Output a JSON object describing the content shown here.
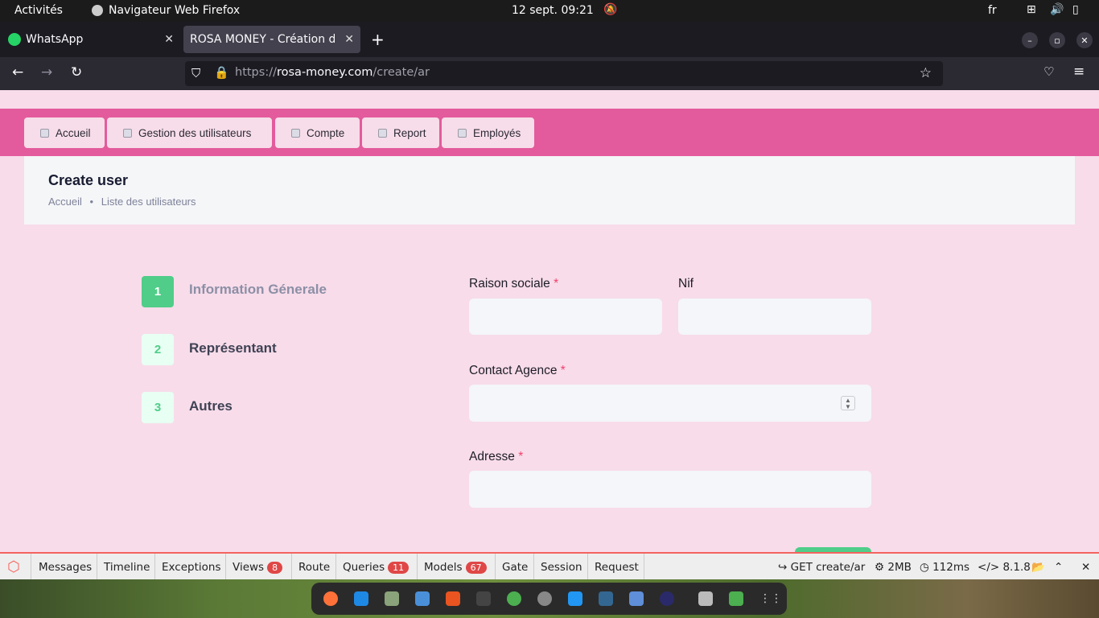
{
  "system_bar": {
    "activities": "Activités",
    "app_name": "Navigateur Web Firefox",
    "datetime": "12 sept.  09:21",
    "lang": "fr"
  },
  "tabs": [
    {
      "label": "WhatsApp"
    },
    {
      "label": "ROSA MONEY - Création d'u"
    }
  ],
  "url": {
    "scheme": "https://",
    "domain": "rosa-money.com",
    "path": "/create/ar"
  },
  "menu": {
    "items": [
      "Accueil",
      "Gestion des utilisateurs",
      "Compte",
      "Report",
      "Employés"
    ]
  },
  "header": {
    "title": "Create user",
    "breadcrumb": [
      "Accueil",
      "Liste des utilisateurs"
    ]
  },
  "steps": [
    {
      "num": "1",
      "label": "Information Génerale"
    },
    {
      "num": "2",
      "label": "Représentant"
    },
    {
      "num": "3",
      "label": "Autres"
    }
  ],
  "form": {
    "raison_sociale": "Raison sociale",
    "nif": "Nif",
    "contact_agence": "Contact Agence",
    "adresse": "Adresse",
    "required_mark": "*"
  },
  "debugbar": {
    "items": [
      "Messages",
      "Timeline",
      "Exceptions",
      "Views",
      "Route",
      "Queries",
      "Models",
      "Gate",
      "Session",
      "Request"
    ],
    "views_count": "8",
    "queries_count": "11",
    "models_count": "67",
    "request": "GET create/ar",
    "memory": "2MB",
    "time": "112ms",
    "php": "8.1.8"
  },
  "colors": {
    "accent": "#e35b9c",
    "page_bg": "#f8dcea",
    "step_active": "#50cd89"
  }
}
